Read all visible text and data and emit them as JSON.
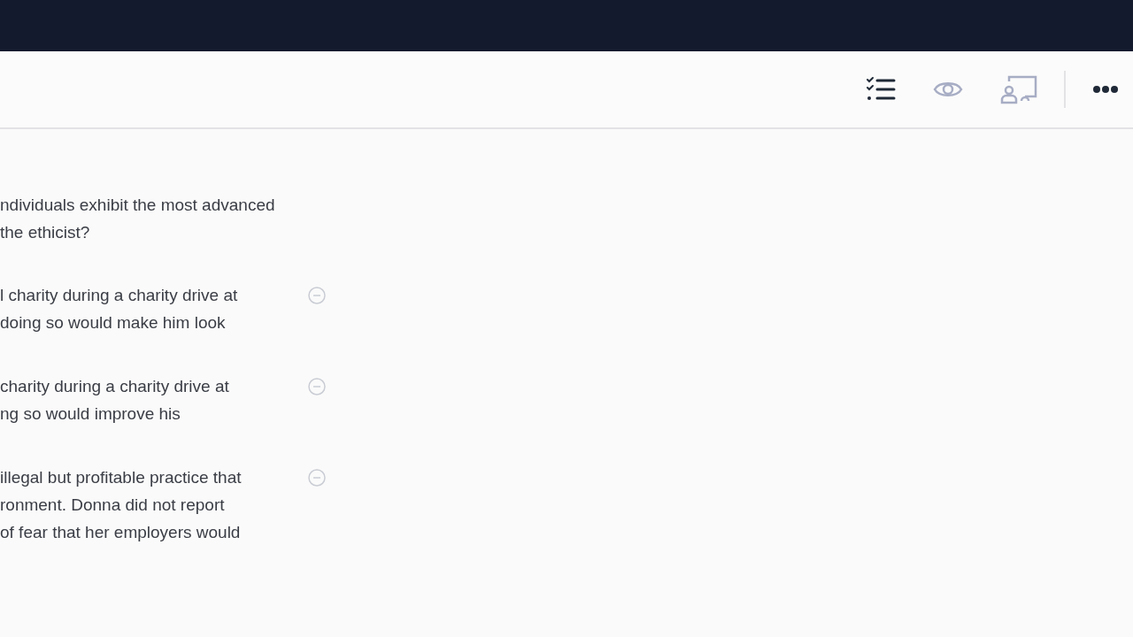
{
  "toolbar": {
    "tools": [
      {
        "kind": "checklist",
        "selected": true
      },
      {
        "kind": "eye",
        "selected": false
      },
      {
        "kind": "presenter",
        "selected": false
      }
    ]
  },
  "question": {
    "lines": [
      "ndividuals exhibit the most advanced",
      "the ethicist?"
    ]
  },
  "options": [
    {
      "lines": [
        "l charity during a charity drive at",
        "doing so would make him look"
      ]
    },
    {
      "lines": [
        "charity during a charity drive at",
        "ng so would improve his"
      ]
    },
    {
      "lines": [
        "illegal but profitable practice that",
        "ronment. Donna did not report",
        "of fear that her employers would"
      ]
    }
  ]
}
